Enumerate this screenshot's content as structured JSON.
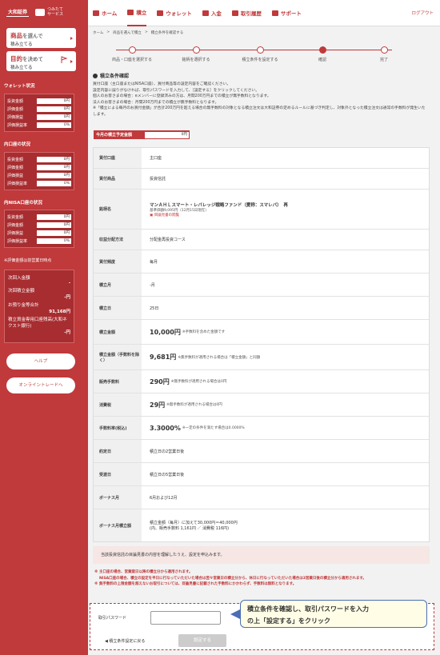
{
  "sidebar": {
    "logo": "大和証券",
    "logo2_line1": "つみたて",
    "logo2_line2": "サービス",
    "btn1": {
      "main": "商品",
      "suffix": "を選んで",
      "sub": "積み立てる"
    },
    "btn2": {
      "main": "目的",
      "suffix": "を決めて",
      "sub": "積み立てる"
    },
    "wallet_title": "ウォレット状況",
    "wallet_rows": [
      {
        "k": "投資金額",
        "v": "0円"
      },
      {
        "k": "評価金額",
        "v": "0円"
      },
      {
        "k": "評価損益",
        "v": "0円"
      },
      {
        "k": "評価損益率",
        "v": "0%"
      }
    ],
    "domestic_title": "内口座の状況",
    "domestic_rows": [
      {
        "k": "投資金額",
        "v": "0円"
      },
      {
        "k": "評価金額",
        "v": "0円"
      },
      {
        "k": "評価損益",
        "v": "0円"
      },
      {
        "k": "評価損益率",
        "v": "0%"
      }
    ],
    "nisa_title": "内NISA口座の状況",
    "nisa_rows": [
      {
        "k": "投資金額",
        "v": "0円"
      },
      {
        "k": "評価金額",
        "v": "0円"
      },
      {
        "k": "評価損益",
        "v": "0円"
      },
      {
        "k": "評価損益率",
        "v": "0%"
      }
    ],
    "note": "※評価金額は前営業日時点",
    "summary": {
      "next_deposit_label": "次回入金額",
      "next_deposit_val": "-",
      "next_invest_label": "次回積立金額",
      "next_invest_val": "-円",
      "deposit_total_label": "お預り金等合計",
      "deposit_total_val": "91,168円",
      "bank_label": "積立資金専用口座残高(大和ネクスト銀行)",
      "bank_val": "-円"
    },
    "help": "ヘルプ",
    "online": "オンライントレードへ"
  },
  "nav": {
    "items": [
      {
        "label": "ホーム"
      },
      {
        "label": "積立"
      },
      {
        "label": "ウォレット"
      },
      {
        "label": "入金"
      },
      {
        "label": "取引履歴"
      },
      {
        "label": "サポート"
      }
    ],
    "logout": "ログアウト"
  },
  "breadcrumb": [
    "ホーム",
    ">",
    "商品を選んで積立",
    ">",
    "積立条件を確認する"
  ],
  "steps": [
    {
      "label": "商品・口座を選択する"
    },
    {
      "label": "銘柄を選択する"
    },
    {
      "label": "積立条件を設定する"
    },
    {
      "label": "確認"
    },
    {
      "label": "完了"
    }
  ],
  "section_title": "積立条件確認",
  "description": [
    "買付口座（主口座またはNISA口座）、買付商品等の設定内容をご確認ください。",
    "設定内容に誤りがなければ、取引パスワードを入力して、［設定する］をクリックしてください。",
    "個人のお客さまの場合：eメンバーに登録済みの方は、月間200万円までの積立が無手数料となります。",
    "法人のお客さまの場合：月間200万円までの積立が無手数料となります。",
    "※「積立による毎月のお買付金額」が合計200万円を超える場合の無手数料の対象となる積立注文は大和証券の定めるルールに基づき判定し、対象外となった積立注文は通常の手数料が発生いたします。"
  ],
  "monthly": {
    "label": "今月の積立予定金額",
    "value": "0円"
  },
  "rows": {
    "account": {
      "k": "買付口座",
      "v": "主口座"
    },
    "product": {
      "k": "買付商品",
      "v": "投資信託"
    },
    "fund": {
      "k": "銘柄名",
      "name": "マンＡＨＬスマート・レバレッジ戦略ファンド（愛称：スマレバ）　再",
      "price": "基準価額9,095円（12月15日現在）",
      "pdf": "目論見書の閲覧"
    },
    "distribution": {
      "k": "収益分配方法",
      "v": "分配金再投資コース"
    },
    "frequency": {
      "k": "買付頻度",
      "v": "毎月"
    },
    "month": {
      "k": "積立月",
      "v": "-月"
    },
    "day": {
      "k": "積立日",
      "v": "25日"
    },
    "amount": {
      "k": "積立金額",
      "num": "10,000円",
      "sub": "※手数料を含めた金額です"
    },
    "amount_ex": {
      "k": "積立金額（手数料を除く）",
      "num": "9,681円",
      "sub": "※無手数料が適用される場合は「積立金額」と同額"
    },
    "fee": {
      "k": "販売手数料",
      "num": "290円",
      "sub": "※無手数料が適用される場合は0円"
    },
    "tax": {
      "k": "消費税",
      "num": "29円",
      "sub": "※無手数料が適用される場合は0円"
    },
    "rate": {
      "k": "手数料率(税込)",
      "num": "3.3000%",
      "sub": "※一定の条件を満たす場合は0.0000%"
    },
    "contract": {
      "k": "約定日",
      "v": "積立日の2営業日後"
    },
    "delivery": {
      "k": "受渡日",
      "v": "積立日の5営業日後"
    },
    "bonus_month": {
      "k": "ボーナス月",
      "v": "6月および12月"
    },
    "bonus_amount": {
      "k": "ボーナス月積立額",
      "v1": "積立金額（毎月）に加えて30,000円＝40,000円",
      "v2": "(内、販売手数料 1,161円 ／ 消費税 116円)"
    }
  },
  "consent": "当該投資信託の目論見書の内容を理解したうえ、設定を申込みます。",
  "notes": [
    "※ 主口座の場合、営業案日以降の積立分から適用されます。",
    "NISA口座の場合、積立の設定を平日に行なっていただいた場合は翌々営業日の積立分から、休日に行なっていただいた場合は3営業日後の積立分から適用されます。",
    "※ 無手数料の上限金額を超えないお取引については、目論見書に記載された手数料にかかわらず、手数料は無料となります。"
  ],
  "password_label": "取引パスワード",
  "back": "◀ 積立条件設定に戻る",
  "set_button": "設定する",
  "callout_line1": "積立条件を確認し、取引パスワードを入力",
  "callout_line2": "の上「設定する」をクリック"
}
